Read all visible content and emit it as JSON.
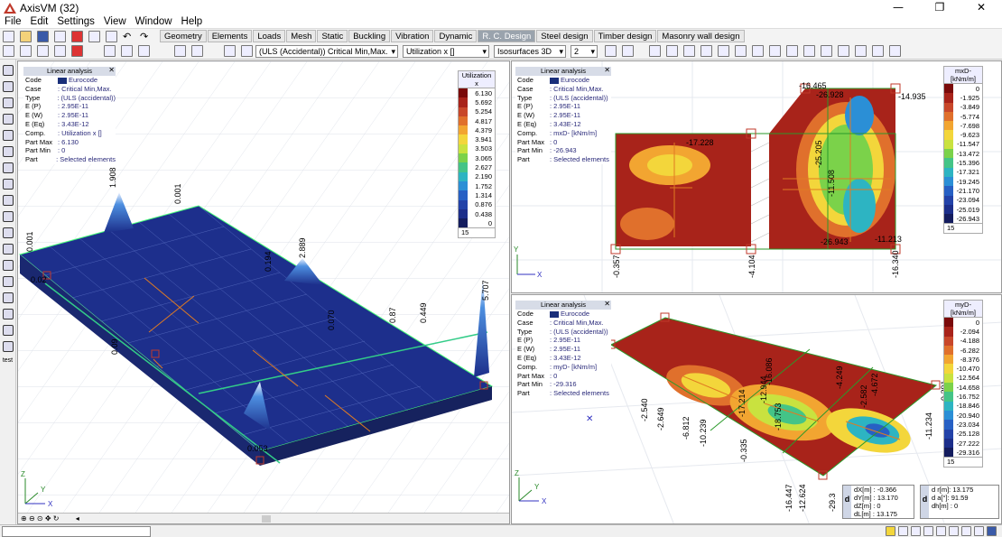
{
  "app": {
    "title": "AxisVM (32)"
  },
  "menu": [
    "File",
    "Edit",
    "Settings",
    "View",
    "Window",
    "Help"
  ],
  "tabs": [
    "Geometry",
    "Elements",
    "Loads",
    "Mesh",
    "Static",
    "Buckling",
    "Vibration",
    "Dynamic",
    "R. C. Design",
    "Steel design",
    "Timber design",
    "Masonry wall design"
  ],
  "active_tab": "R. C. Design",
  "toolbar2": {
    "loadcase": "(ULS (Accidental)) Critical Min,Max.",
    "component": "Utilization x []",
    "display": "Isosurfaces 3D",
    "spin": "2"
  },
  "left_tool_label": "test",
  "views": {
    "left": {
      "info": {
        "title": "Linear analysis",
        "rows": [
          {
            "k": "Code",
            "v": "Eurocode",
            "swatch": true
          },
          {
            "k": "Case",
            "v": ": Critical Min,Max."
          },
          {
            "k": "Type",
            "v": ": (ULS (accidental))"
          },
          {
            "k": "E (P)",
            "v": ": 2.95E-11"
          },
          {
            "k": "E (W)",
            "v": ": 2.95E-11"
          },
          {
            "k": "E (Eq)",
            "v": ": 3.43E-12"
          },
          {
            "k": "Comp.",
            "v": ": Utilization x []"
          },
          {
            "k": "Part Max",
            "v": ": 6.130"
          },
          {
            "k": "Part Min",
            "v": ": 0"
          },
          {
            "k": "Part",
            "v": ": Selected elements"
          }
        ]
      },
      "legend": {
        "title": "Utilization x",
        "values": [
          "6.130",
          "5.692",
          "5.254",
          "4.817",
          "4.379",
          "3.941",
          "3.503",
          "3.065",
          "2.627",
          "2.190",
          "1.752",
          "1.314",
          "0.876",
          "0.438",
          "0"
        ],
        "colors": [
          "#7a0a0a",
          "#a8231a",
          "#c8472a",
          "#e0702c",
          "#f2a531",
          "#f3d63b",
          "#c9e23f",
          "#7bd24a",
          "#44c487",
          "#2db4c2",
          "#2b8fd6",
          "#2760c4",
          "#2342a8",
          "#1c2e8a",
          "#141c5e"
        ],
        "footer": "15"
      },
      "labels": [
        "1.908",
        "0.001",
        "0.194",
        "2.889",
        "0.070",
        "5.707",
        "0.449",
        "0.87",
        "0.09",
        "0.053",
        "0.001",
        "0.02"
      ]
    },
    "top_right": {
      "info": {
        "title": "Linear analysis",
        "rows": [
          {
            "k": "Code",
            "v": "Eurocode",
            "swatch": true
          },
          {
            "k": "Case",
            "v": ": Critical Min,Max."
          },
          {
            "k": "Type",
            "v": ": (ULS (accidental))"
          },
          {
            "k": "E (P)",
            "v": ": 2.95E-11"
          },
          {
            "k": "E (W)",
            "v": ": 2.95E-11"
          },
          {
            "k": "E (Eq)",
            "v": ": 3.43E-12"
          },
          {
            "k": "Comp.",
            "v": ": mxD- [kNm/m]"
          },
          {
            "k": "Part Max",
            "v": ": 0"
          },
          {
            "k": "Part Min",
            "v": ": -26.943"
          },
          {
            "k": "Part",
            "v": ": Selected elements"
          }
        ]
      },
      "legend": {
        "title": "mxD-\n[kNm/m]",
        "values": [
          "0",
          "-1.925",
          "-3.849",
          "-5.774",
          "-7.698",
          "-9.623",
          "-11.547",
          "-13.472",
          "-15.396",
          "-17.321",
          "-19.245",
          "-21.170",
          "-23.094",
          "-25.019",
          "-26.943"
        ],
        "colors": [
          "#7a0a0a",
          "#a8231a",
          "#c8472a",
          "#e0702c",
          "#f2a531",
          "#f3d63b",
          "#c9e23f",
          "#7bd24a",
          "#44c487",
          "#2db4c2",
          "#2b8fd6",
          "#2760c4",
          "#2342a8",
          "#1c2e8a",
          "#141c5e"
        ],
        "footer": "15"
      },
      "labels": [
        "-16.465",
        "-26.928",
        "-14.935",
        "-17.228",
        "-25.205",
        "-11.508",
        "-26.943",
        "-11.213",
        "-0.357",
        "-4.104",
        "-16.340"
      ]
    },
    "bottom_right": {
      "info": {
        "title": "Linear analysis",
        "rows": [
          {
            "k": "Code",
            "v": "Eurocode",
            "swatch": true
          },
          {
            "k": "Case",
            "v": ": Critical Min,Max."
          },
          {
            "k": "Type",
            "v": ": (ULS (accidental))"
          },
          {
            "k": "E (P)",
            "v": ": 2.95E-11"
          },
          {
            "k": "E (W)",
            "v": ": 2.95E-11"
          },
          {
            "k": "E (Eq)",
            "v": ": 3.43E-12"
          },
          {
            "k": "Comp.",
            "v": ": myD- [kNm/m]"
          },
          {
            "k": "Part Max",
            "v": ": 0"
          },
          {
            "k": "Part Min",
            "v": ": -29.316"
          },
          {
            "k": "Part",
            "v": ": Selected elements"
          }
        ]
      },
      "legend": {
        "title": "myD-\n[kNm/m]",
        "values": [
          "0",
          "-2.094",
          "-4.188",
          "-6.282",
          "-8.376",
          "-10.470",
          "-12.564",
          "-14.658",
          "-16.752",
          "-18.846",
          "-20.940",
          "-23.034",
          "-25.128",
          "-27.222",
          "-29.316"
        ],
        "colors": [
          "#7a0a0a",
          "#a8231a",
          "#c8472a",
          "#e0702c",
          "#f2a531",
          "#f3d63b",
          "#c9e23f",
          "#7bd24a",
          "#44c487",
          "#2db4c2",
          "#2b8fd6",
          "#2760c4",
          "#2342a8",
          "#1c2e8a",
          "#141c5e"
        ],
        "footer": "15"
      },
      "labels": [
        "-2.540",
        "-2.649",
        "-6.812",
        "-10.239",
        "-0.335",
        "-17.214",
        "-12.944",
        "-16.086",
        "-2.582",
        "-4.672",
        "-4.249",
        "-11.234",
        "-9.291",
        "-16.447",
        "-12.624",
        "-29.3",
        "-18.753"
      ]
    }
  },
  "coords": {
    "left": [
      "dX[m]  : -0.366",
      "dY[m]  : 13.170",
      "dZ[m]  : 0",
      "dL[m]  : 13.175"
    ],
    "right": [
      "d r[m]: 13.175",
      "d a[°]: 91.59",
      "dh[m]  : 0"
    ]
  }
}
